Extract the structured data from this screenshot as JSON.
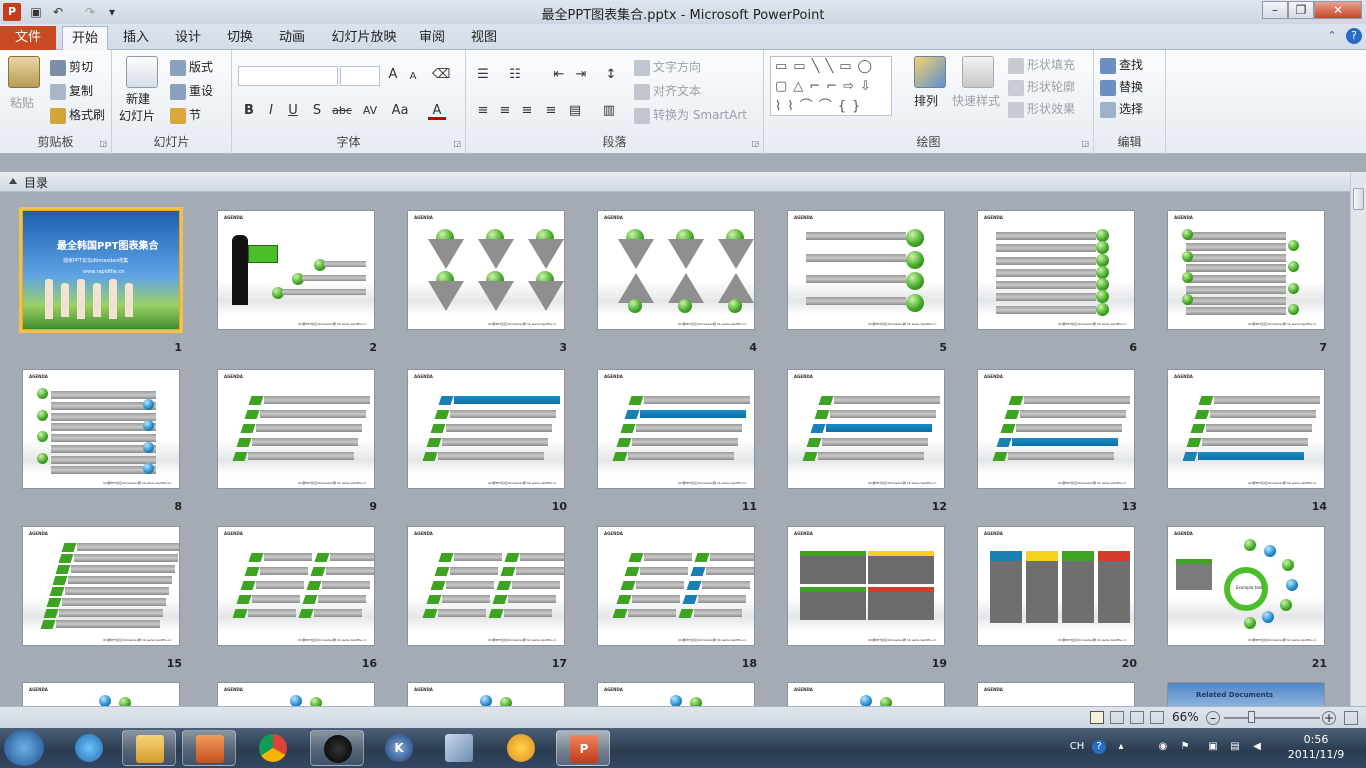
{
  "window": {
    "title": "最全PPT图表集合.pptx - Microsoft PowerPoint"
  },
  "tabs": {
    "file": "文件",
    "home": "开始",
    "insert": "插入",
    "design": "设计",
    "transitions": "切换",
    "animations": "动画",
    "slideshow": "幻灯片放映",
    "review": "审阅",
    "view": "视图"
  },
  "ribbon": {
    "clipboard": {
      "label": "剪贴板",
      "paste": "粘贴",
      "cut": "剪切",
      "copy": "复制",
      "format_painter": "格式刷"
    },
    "slides": {
      "label": "幻灯片",
      "new_slide": "新建",
      "new_slide2": "幻灯片",
      "layout": "版式",
      "reset": "重设",
      "section": "节"
    },
    "font": {
      "label": "字体",
      "bold": "B",
      "italic": "I",
      "underline": "U",
      "shadow": "S",
      "strike": "abc",
      "spacing": "AV",
      "case": "Aa",
      "color": "A",
      "grow": "A",
      "shrink": "A"
    },
    "paragraph": {
      "label": "段落",
      "text_direction": "文字方向",
      "align_text": "对齐文本",
      "smartart": "转换为 SmartArt"
    },
    "drawing": {
      "label": "绘图",
      "arrange": "排列",
      "quick_styles": "快速样式",
      "shape_fill": "形状填充",
      "shape_outline": "形状轮廓",
      "shape_effects": "形状效果"
    },
    "editing": {
      "label": "编辑",
      "find": "查找",
      "replace": "替换",
      "select": "选择"
    }
  },
  "section": {
    "name": "目录"
  },
  "slide1": {
    "title": "最全韩国PPT图表集合",
    "subtitle": "独家PPT论坛dbmasdao收集",
    "url": "www.rapidfile.cn"
  },
  "slides": [
    {
      "number": "1"
    },
    {
      "number": "2"
    },
    {
      "number": "3"
    },
    {
      "number": "4"
    },
    {
      "number": "5"
    },
    {
      "number": "6"
    },
    {
      "number": "7"
    },
    {
      "number": "8"
    },
    {
      "number": "9"
    },
    {
      "number": "10"
    },
    {
      "number": "11"
    },
    {
      "number": "12"
    },
    {
      "number": "13"
    },
    {
      "number": "14"
    },
    {
      "number": "15"
    },
    {
      "number": "16"
    },
    {
      "number": "17"
    },
    {
      "number": "18"
    },
    {
      "number": "19"
    },
    {
      "number": "20"
    },
    {
      "number": "21"
    }
  ],
  "slide_text": {
    "agenda": "AGENDA",
    "footer": "QQ群PPT论坛dbmasdao群 hb  www.rapidfile.cn",
    "related": "Related Documents",
    "sample": "Example text"
  },
  "status": {
    "zoom": "66%"
  },
  "taskbar": {
    "ime": "CH",
    "time": "0:56",
    "date": "2011/11/9"
  },
  "colors": {
    "file_tab": "#c94a22",
    "selection": "#f0c050",
    "green": "#3da321",
    "blue": "#1a7fb3"
  }
}
